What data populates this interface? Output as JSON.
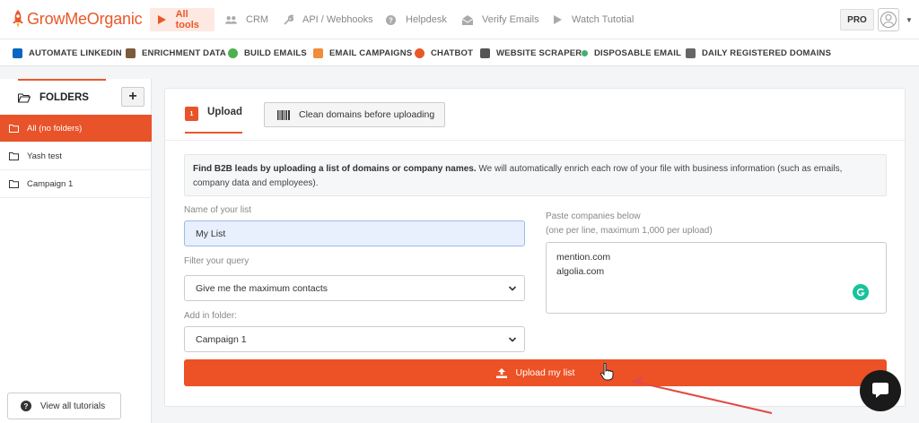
{
  "app": {
    "brand": "GrowMeOrganic",
    "brand_color": "#e8582a"
  },
  "top_nav": [
    {
      "label": "All tools",
      "icon": "play-icon",
      "active": true
    },
    {
      "label": "CRM",
      "icon": "users-icon",
      "active": false
    },
    {
      "label": "API / Webhooks",
      "icon": "wrench-icon",
      "active": false
    },
    {
      "label": "Helpdesk",
      "icon": "question-icon",
      "active": false
    },
    {
      "label": "Verify Emails",
      "icon": "envelope-icon",
      "active": false
    },
    {
      "label": "Watch Tutotial",
      "icon": "play-icon",
      "active": false
    }
  ],
  "account": {
    "plan_badge": "PRO"
  },
  "tools": [
    {
      "label": "AUTOMATE LINKEDIN",
      "icon": "linkedin-icon",
      "color": "#0a66c2"
    },
    {
      "label": "ENRICHMENT DATA",
      "icon": "coffee-icon",
      "color": "#7b5b3a"
    },
    {
      "label": "BUILD EMAILS",
      "icon": "globe-icon",
      "color": "#4caf50"
    },
    {
      "label": "EMAIL CAMPAIGNS",
      "icon": "mail-icon",
      "color": "#f08c3a"
    },
    {
      "label": "CHATBOT",
      "icon": "chat-icon",
      "color": "#e8582a"
    },
    {
      "label": "WEBSITE SCRAPER",
      "icon": "scraper-icon",
      "color": "#555555"
    },
    {
      "label": "DISPOSABLE EMAIL",
      "icon": "dot-icon",
      "color": "#3cb371"
    },
    {
      "label": "DAILY REGISTERED DOMAINS",
      "icon": "briefcase-icon",
      "color": "#666666"
    }
  ],
  "sidebar": {
    "title": "FOLDERS",
    "add_label": "+",
    "folders": [
      {
        "label": "All (no folders)",
        "active": true
      },
      {
        "label": "Yash test",
        "active": false
      },
      {
        "label": "Campaign 1",
        "active": false
      }
    ],
    "tutorials_label": "View all tutorials"
  },
  "main": {
    "step_number": "1",
    "tab_upload": "Upload",
    "clean_domains_label": "Clean domains before uploading",
    "info_bold": "Find B2B leads by uploading a list of domains or company names.",
    "info_rest": " We will automatically enrich each row of your file with business information (such as emails, company data and employees).",
    "name_label": "Name of your list",
    "name_value": "My List",
    "filter_label": "Filter your query",
    "filter_value": "Give me the maximum contacts",
    "folder_label": "Add in folder:",
    "folder_value": "Campaign 1",
    "paste_label": "Paste companies below",
    "paste_hint": "(one per line, maximum 1,000 per upload)",
    "paste_lines": [
      "mention.com",
      "algolia.com"
    ],
    "upload_button": "Upload my list",
    "accent": "#ec5225"
  }
}
